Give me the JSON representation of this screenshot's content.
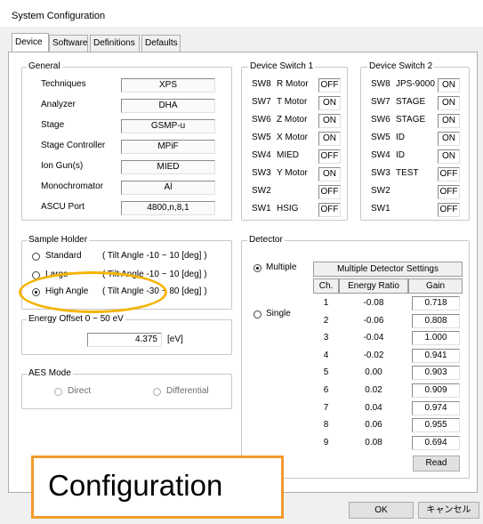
{
  "window": {
    "title": "System Configuration"
  },
  "tabs": [
    {
      "label": "Device",
      "active": true
    },
    {
      "label": "Software",
      "active": false
    },
    {
      "label": "Definitions",
      "active": false
    },
    {
      "label": "Defaults",
      "active": false
    }
  ],
  "general": {
    "title": "General",
    "rows": [
      {
        "label": "Techniques",
        "value": "XPS"
      },
      {
        "label": "Analyzer",
        "value": "DHA"
      },
      {
        "label": "Stage",
        "value": "GSMP-u"
      },
      {
        "label": "Stage Controller",
        "value": "MPiF"
      },
      {
        "label": "Ion Gun(s)",
        "value": "MIED"
      },
      {
        "label": "Monochromator",
        "value": "Al"
      },
      {
        "label": "ASCU Port",
        "value": "4800,n,8,1"
      }
    ]
  },
  "switch1": {
    "title": "Device Switch 1",
    "rows": [
      {
        "sw": "SW8",
        "name": "R Motor",
        "state": "OFF"
      },
      {
        "sw": "SW7",
        "name": "T Motor",
        "state": "ON"
      },
      {
        "sw": "SW6",
        "name": "Z Motor",
        "state": "ON"
      },
      {
        "sw": "SW5",
        "name": "X Motor",
        "state": "ON"
      },
      {
        "sw": "SW4",
        "name": "MIED",
        "state": "OFF"
      },
      {
        "sw": "SW3",
        "name": "Y Motor",
        "state": "ON"
      },
      {
        "sw": "SW2",
        "name": "",
        "state": "OFF"
      },
      {
        "sw": "SW1",
        "name": "HSIG",
        "state": "OFF"
      }
    ]
  },
  "switch2": {
    "title": "Device Switch 2",
    "rows": [
      {
        "sw": "SW8",
        "name": "JPS-9000",
        "state": "ON"
      },
      {
        "sw": "SW7",
        "name": "STAGE",
        "state": "ON"
      },
      {
        "sw": "SW6",
        "name": "STAGE",
        "state": "ON"
      },
      {
        "sw": "SW5",
        "name": "ID",
        "state": "ON"
      },
      {
        "sw": "SW4",
        "name": "ID",
        "state": "ON"
      },
      {
        "sw": "SW3",
        "name": "TEST",
        "state": "OFF"
      },
      {
        "sw": "SW2",
        "name": "",
        "state": "OFF"
      },
      {
        "sw": "SW1",
        "name": "",
        "state": "OFF"
      }
    ]
  },
  "sample_holder": {
    "title": "Sample Holder",
    "options": [
      {
        "label": "Standard",
        "range": "( Tilt Angle -10 ~ 10 [deg] )",
        "selected": false
      },
      {
        "label": "Large",
        "range": "( Tilt Angle -10 ~ 10 [deg] )",
        "selected": false
      },
      {
        "label": "High Angle",
        "range": "( Tilt Angle -30 ~ 80 [deg] )",
        "selected": true
      }
    ]
  },
  "energy_offset": {
    "title": "Energy Offset 0 ~ 50 eV",
    "value": "4.375",
    "unit": "[eV]"
  },
  "aes_mode": {
    "title": "AES Mode",
    "options": [
      {
        "label": "Direct",
        "selected": false
      },
      {
        "label": "Differential",
        "selected": false
      }
    ]
  },
  "detector": {
    "title": "Detector",
    "modes": [
      {
        "label": "Multiple",
        "selected": true
      },
      {
        "label": "Single",
        "selected": false
      }
    ],
    "settings_title": "Multiple Detector Settings",
    "headers": [
      "Ch.",
      "Energy Ratio",
      "Gain"
    ],
    "rows": [
      {
        "ch": "1",
        "ratio": "-0.08",
        "gain": "0.718"
      },
      {
        "ch": "2",
        "ratio": "-0.06",
        "gain": "0.808"
      },
      {
        "ch": "3",
        "ratio": "-0.04",
        "gain": "1.000"
      },
      {
        "ch": "4",
        "ratio": "-0.02",
        "gain": "0.941"
      },
      {
        "ch": "5",
        "ratio": "0.00",
        "gain": "0.903"
      },
      {
        "ch": "6",
        "ratio": "0.02",
        "gain": "0.909"
      },
      {
        "ch": "7",
        "ratio": "0.04",
        "gain": "0.974"
      },
      {
        "ch": "8",
        "ratio": "0.06",
        "gain": "0.955"
      },
      {
        "ch": "9",
        "ratio": "0.08",
        "gain": "0.694"
      }
    ],
    "read_label": "Read"
  },
  "footer": {
    "ok_label": "OK",
    "cancel_label": "キャンセル"
  },
  "callout": {
    "text": "Configuration",
    "border_color": "#f39a2e"
  },
  "highlight": {
    "color": "#f5b400"
  }
}
